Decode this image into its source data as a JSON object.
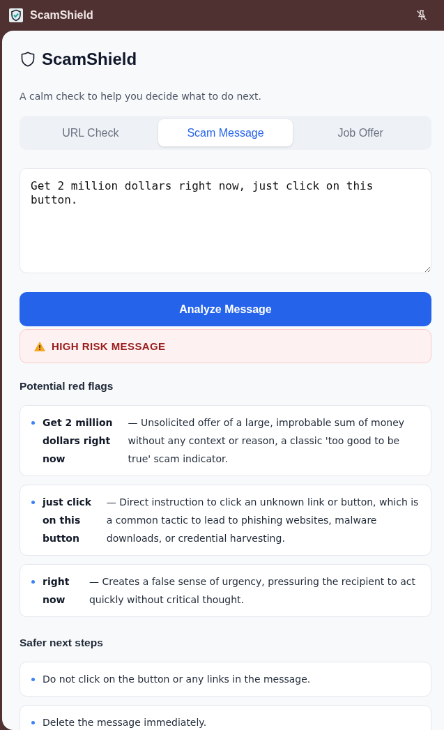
{
  "window": {
    "title": "ScamShield"
  },
  "header": {
    "title": "ScamShield",
    "subtitle": "A calm check to help you decide what to do next."
  },
  "tabs": [
    {
      "label": "URL Check",
      "selected": false
    },
    {
      "label": "Scam Message",
      "selected": true
    },
    {
      "label": "Job Offer",
      "selected": false
    }
  ],
  "message_field": {
    "value": "Get 2 million dollars right now, just click on this button."
  },
  "analyze_button": {
    "label": "Analyze Message"
  },
  "risk_alert": {
    "label": "HIGH RISK MESSAGE"
  },
  "red_flags": {
    "heading": "Potential red flags",
    "items": [
      {
        "phrase": "Get 2 million dollars right now",
        "explanation": "— Unsolicited offer of a large, improbable sum of money without any context or reason, a classic 'too good to be true' scam indicator."
      },
      {
        "phrase": "just click on this button",
        "explanation": "— Direct instruction to click an unknown link or button, which is a common tactic to lead to phishing websites, malware downloads, or credential harvesting."
      },
      {
        "phrase": "right now",
        "explanation": "— Creates a false sense of urgency, pressuring the recipient to act quickly without critical thought."
      }
    ]
  },
  "next_steps": {
    "heading": "Safer next steps",
    "items": [
      "Do not click on the button or any links in the message.",
      "Delete the message immediately."
    ]
  }
}
